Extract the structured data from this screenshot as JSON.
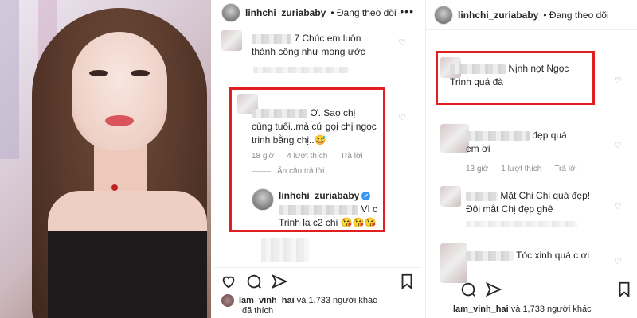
{
  "post": {
    "username": "linhchi_zuriababy",
    "follow_status": "• Đang theo dõi",
    "more": "•••"
  },
  "left_comments": {
    "comment1": {
      "text_part": "7 Chúc em luôn",
      "text_line2": "thành công như mong ước"
    },
    "comment2": {
      "text_part": "Ơ. Sao chị",
      "text_line2": "cùng tuổi..mà cứ gọi chị ngọc",
      "text_line3": "trinh bằng chị..",
      "emoji": "😅",
      "time": "18 giờ",
      "likes": "4 lượt thích",
      "reply": "Trả lời",
      "hide_replies": "Ẩn câu trả lời"
    },
    "reply": {
      "username": "linhchi_zuriababy",
      "verified": "✔",
      "text_part": "Vì c",
      "text_line2": "Trinh la c2 chị",
      "emoji": "😘😘😘"
    }
  },
  "right_comments": {
    "comment1": {
      "text_part": "Nịnh nọt Ngọc",
      "text_line2": "Trinh quá đà"
    },
    "comment2": {
      "text_part": "đẹp quá",
      "text_line2": "em ơi",
      "time": "13 giờ",
      "likes": "1 lượt thích",
      "reply": "Trả lời"
    },
    "comment3": {
      "text_part": "Mặt Chị Chi quá đẹp!",
      "text_line2": "Đôi mắt Chị đẹp ghê"
    },
    "comment4": {
      "text_part": "Tóc xinh quá c ơi"
    }
  },
  "likes_line": {
    "user": "lam_vinh_hai",
    "rest": "và 1,733 người khác",
    "line2": "đã thích"
  },
  "colors": {
    "highlight_border": "#e02020",
    "verified": "#3897f0"
  },
  "icons": [
    "heart-icon",
    "comment-icon",
    "share-icon",
    "bookmark-icon"
  ]
}
